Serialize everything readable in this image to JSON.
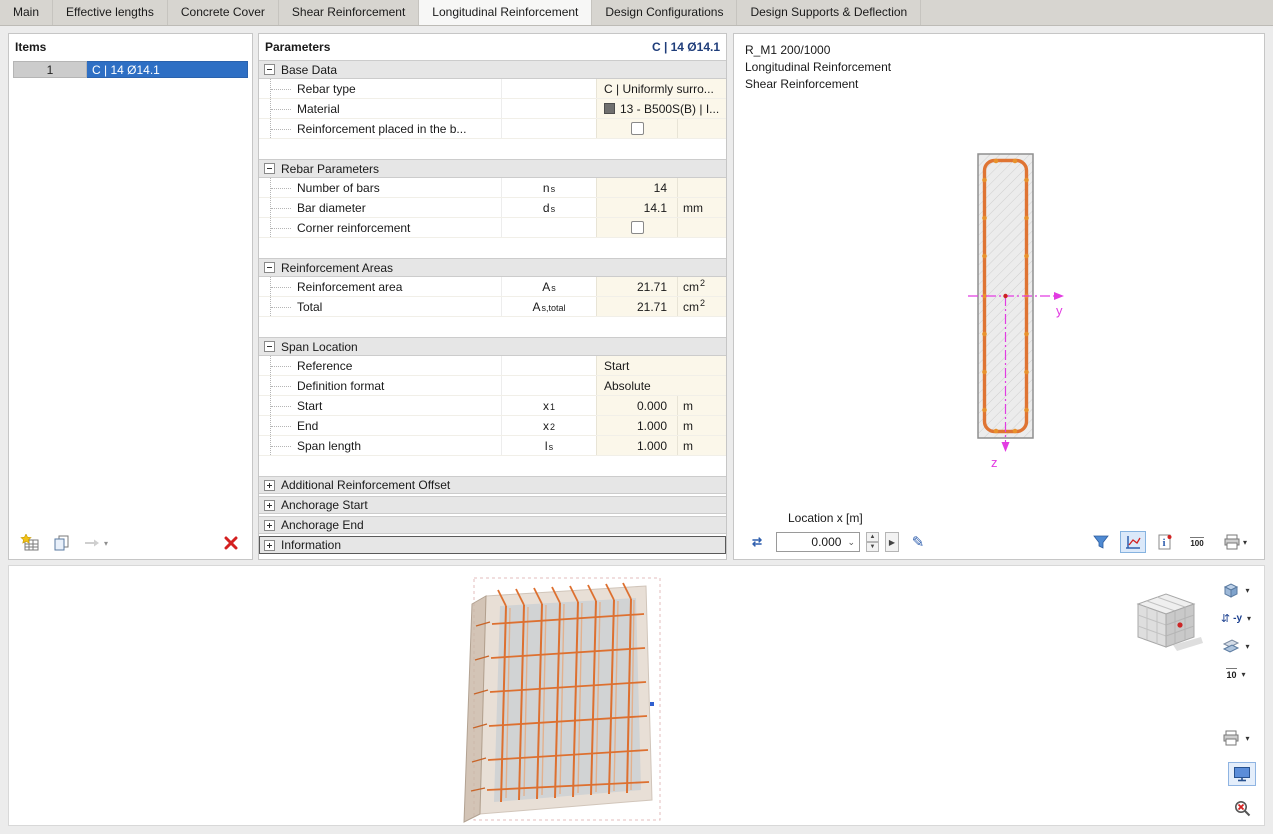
{
  "tabs": {
    "items": [
      {
        "label": "Main"
      },
      {
        "label": "Effective lengths"
      },
      {
        "label": "Concrete Cover"
      },
      {
        "label": "Shear Reinforcement"
      },
      {
        "label": "Longitudinal Reinforcement"
      },
      {
        "label": "Design Configurations"
      },
      {
        "label": "Design Supports & Deflection"
      }
    ],
    "active_index": 4
  },
  "items_panel": {
    "title": "Items",
    "rows": [
      {
        "num": "1",
        "label": "C | 14 Ø14.1"
      }
    ]
  },
  "parameters": {
    "title": "Parameters",
    "header_value": "C | 14 Ø14.1",
    "groups": [
      {
        "label": "Base Data",
        "rows": [
          {
            "label": "Rebar type",
            "value": "C | Uniformly surro..."
          },
          {
            "label": "Material",
            "value": "13 - B500S(B) | I..."
          },
          {
            "label": "Reinforcement placed in the b..."
          }
        ]
      },
      {
        "label": "Rebar Parameters",
        "rows": [
          {
            "label": "Number of bars",
            "sym": "n",
            "sym_sub": "s",
            "value": "14"
          },
          {
            "label": "Bar diameter",
            "sym": "d",
            "sym_sub": "s",
            "value": "14.1",
            "unit": "mm"
          },
          {
            "label": "Corner reinforcement"
          }
        ]
      },
      {
        "label": "Reinforcement Areas",
        "rows": [
          {
            "label": "Reinforcement area",
            "sym": "A",
            "sym_sub": "s",
            "value": "21.71",
            "unit": "cm",
            "unit_sup": "2"
          },
          {
            "label": "Total",
            "sym": "A",
            "sym_sub": "s,total",
            "value": "21.71",
            "unit": "cm",
            "unit_sup": "2"
          }
        ]
      },
      {
        "label": "Span Location",
        "rows": [
          {
            "label": "Reference",
            "value": "Start"
          },
          {
            "label": "Definition format",
            "value": "Absolute"
          },
          {
            "label": "Start",
            "sym": "x",
            "sym_sub": "1",
            "value": "0.000",
            "unit": "m"
          },
          {
            "label": "End",
            "sym": "x",
            "sym_sub": "2",
            "value": "1.000",
            "unit": "m"
          },
          {
            "label": "Span length",
            "sym": "l",
            "sym_sub": "s",
            "value": "1.000",
            "unit": "m"
          }
        ]
      },
      {
        "label": "Additional Reinforcement Offset"
      },
      {
        "label": "Anchorage Start"
      },
      {
        "label": "Anchorage End"
      },
      {
        "label": "Information"
      }
    ]
  },
  "section_view": {
    "title_lines": [
      "R_M1 200/1000",
      "Longitudinal Reinforcement",
      "Shear Reinforcement"
    ],
    "axis_y": "y",
    "axis_z": "z",
    "location_label": "Location x [m]",
    "location_value": "0.000"
  },
  "toolbar": {
    "scale_label": "100"
  },
  "viewport": {
    "view_direction": "-y",
    "grid_value": "10"
  },
  "colors": {
    "selection_blue": "#2e6fc4",
    "rebar_orange": "#df7433",
    "axis_magenta": "#e23ce2",
    "delete_red": "#d42020",
    "header_navy": "#1f3d7a",
    "material_swatch": "#6f6f6f"
  }
}
